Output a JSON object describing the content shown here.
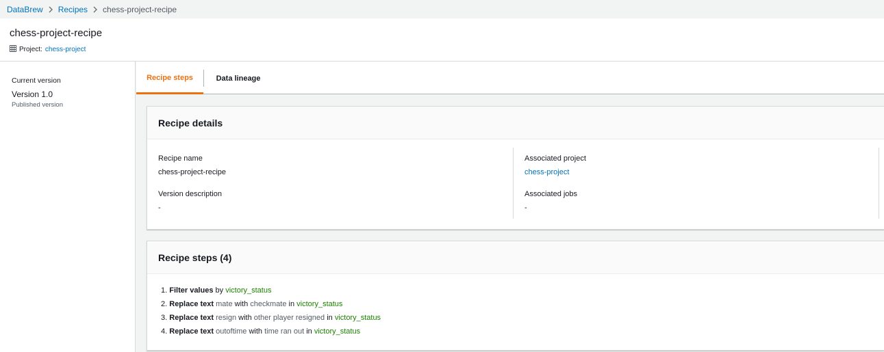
{
  "breadcrumb": {
    "items": [
      {
        "label": "DataBrew"
      },
      {
        "label": "Recipes"
      },
      {
        "label": "chess-project-recipe"
      }
    ]
  },
  "header": {
    "title": "chess-project-recipe",
    "project_label": "Project:",
    "project_value": "chess-project"
  },
  "sidebar": {
    "current_version_label": "Current version",
    "version": "Version 1.0",
    "version_status": "Published version"
  },
  "tabs": [
    {
      "label": "Recipe steps",
      "active": true
    },
    {
      "label": "Data lineage",
      "active": false
    }
  ],
  "details": {
    "title": "Recipe details",
    "recipe_name_label": "Recipe name",
    "recipe_name_value": "chess-project-recipe",
    "version_description_label": "Version description",
    "version_description_value": "-",
    "associated_project_label": "Associated project",
    "associated_project_value": "chess-project",
    "associated_jobs_label": "Associated jobs",
    "associated_jobs_value": "-"
  },
  "steps": {
    "title": "Recipe steps (4)",
    "items": [
      {
        "num": "1.",
        "action": "Filter values",
        "w1": "by",
        "column": "victory_status"
      },
      {
        "num": "2.",
        "action": "Replace text",
        "from": "mate",
        "w1": "with",
        "to": "checkmate",
        "w2": "in",
        "column": "victory_status"
      },
      {
        "num": "3.",
        "action": "Replace text",
        "from": "resign",
        "w1": "with",
        "to": "other player resigned",
        "w2": "in",
        "column": "victory_status"
      },
      {
        "num": "4.",
        "action": "Replace text",
        "from": "outoftime",
        "w1": "with",
        "to": "time ran out",
        "w2": "in",
        "column": "victory_status"
      }
    ]
  },
  "colors": {
    "link": "#0073bb",
    "active_tab": "#ec7211",
    "column_name": "#1d8102"
  }
}
